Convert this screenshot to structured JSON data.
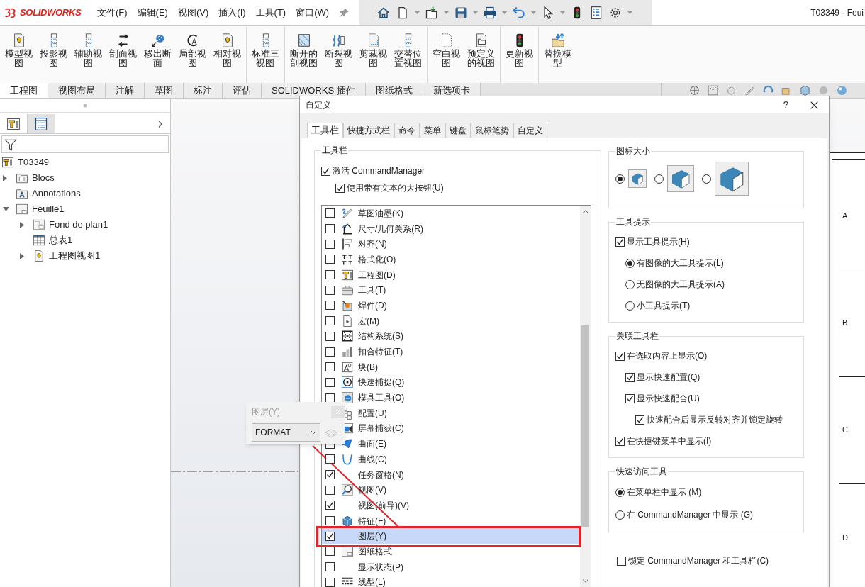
{
  "menu_bar": {
    "logo": "SOLIDWORKS",
    "menus": [
      "文件(F)",
      "编辑(E)",
      "视图(V)",
      "插入(I)",
      "工具(T)",
      "窗口(W)"
    ],
    "title": "T03349 - Feui"
  },
  "command_manager": {
    "groups": [
      [
        {
          "label": "模型视图"
        },
        {
          "label": "投影视图"
        },
        {
          "label": "辅助视图"
        },
        {
          "label": "剖面视图"
        },
        {
          "label": "移出断面"
        },
        {
          "label": "局部视图"
        },
        {
          "label": "相对视图"
        }
      ],
      [
        {
          "label": "标准三视图"
        }
      ],
      [
        {
          "label": "断开的剖视图"
        },
        {
          "label": "断裂视图"
        },
        {
          "label": "剪裁视图"
        },
        {
          "label": "交替位置视图"
        }
      ],
      [
        {
          "label": "空白视图"
        },
        {
          "label": "预定义的视图"
        }
      ],
      [
        {
          "label": "更新视图"
        }
      ],
      [
        {
          "label": "替换模型"
        }
      ]
    ]
  },
  "command_tabs": [
    {
      "label": "工程图",
      "selected": true
    },
    {
      "label": "视图布局",
      "selected": false
    },
    {
      "label": "注解",
      "selected": false
    },
    {
      "label": "草图",
      "selected": false
    },
    {
      "label": "标注",
      "selected": false
    },
    {
      "label": "评估",
      "selected": false
    },
    {
      "label": "SOLIDWORKS 插件",
      "selected": false
    },
    {
      "label": "图纸格式",
      "selected": false
    },
    {
      "label": "新选项卡",
      "selected": false
    }
  ],
  "feature_manager": {
    "tabs": [
      {
        "selected": true
      },
      {
        "selected": false
      }
    ],
    "tree": [
      {
        "label": "T03349",
        "kind": "drawing",
        "children": [
          {
            "label": "Blocs",
            "kind": "blocks",
            "expanded": false
          },
          {
            "label": "Annotations",
            "kind": "annotations"
          },
          {
            "label": "Feuille1",
            "kind": "sheet",
            "expanded": true,
            "children": [
              {
                "label": "Fond de plan1",
                "kind": "sheet_format",
                "expanded": false
              },
              {
                "label": "总表1",
                "kind": "table"
              },
              {
                "label": "工程图视图1",
                "kind": "view",
                "expanded": false
              }
            ]
          }
        ]
      }
    ]
  },
  "sheet": {
    "zones": [
      "A",
      "B",
      "C",
      "D"
    ]
  },
  "layer_toolbar": {
    "title": "图层(Y)",
    "layer": "FORMAT"
  },
  "dialog": {
    "title": "自定义",
    "help": "?",
    "tabs": [
      {
        "label": "工具栏",
        "selected": true
      },
      {
        "label": "快捷方式栏",
        "selected": false
      },
      {
        "label": "命令",
        "selected": false
      },
      {
        "label": "菜单",
        "selected": false
      },
      {
        "label": "键盘",
        "selected": false
      },
      {
        "label": "鼠标笔势",
        "selected": false
      },
      {
        "label": "自定义",
        "selected": false
      }
    ],
    "toolbars": {
      "title": "工具栏",
      "options": [
        {
          "kind": "checkbox",
          "label": "激活 CommandManager",
          "checked": true,
          "children": [
            {
              "kind": "checkbox",
              "label": "使用带有文本的大按钮(U)",
              "checked": true
            }
          ]
        }
      ],
      "list": [
        {
          "label": "草图油墨(K)",
          "checked": false,
          "selected": false
        },
        {
          "label": "尺寸/几何关系(R)",
          "checked": false,
          "selected": false
        },
        {
          "label": "对齐(N)",
          "checked": false,
          "selected": false
        },
        {
          "label": "格式化(O)",
          "checked": false,
          "selected": false
        },
        {
          "label": "工程图(D)",
          "checked": false,
          "selected": false
        },
        {
          "label": "工具(T)",
          "checked": false,
          "selected": false
        },
        {
          "label": "焊件(D)",
          "checked": false,
          "selected": false
        },
        {
          "label": "宏(M)",
          "checked": false,
          "selected": false
        },
        {
          "label": "结构系统(S)",
          "checked": false,
          "selected": false
        },
        {
          "label": "扣合特征(T)",
          "checked": false,
          "selected": false
        },
        {
          "label": "块(B)",
          "checked": false,
          "selected": false
        },
        {
          "label": "快速捕捉(Q)",
          "checked": false,
          "selected": false
        },
        {
          "label": "模具工具(O)",
          "checked": false,
          "selected": false
        },
        {
          "label": "配置(U)",
          "selected": false
        },
        {
          "label": "屏幕捕获(C)",
          "selected": false
        },
        {
          "label": "曲面(E)",
          "checked": false,
          "selected": false
        },
        {
          "label": "曲线(C)",
          "checked": false,
          "selected": false
        },
        {
          "label": "任务窗格(N)",
          "checked": true,
          "selected": false
        },
        {
          "label": "视图(V)",
          "checked": false,
          "selected": false
        },
        {
          "label": "视图(前导)(V)",
          "checked": true,
          "selected": false
        },
        {
          "label": "特征(F)",
          "checked": false,
          "selected": false
        },
        {
          "label": "图层(Y)",
          "checked": true,
          "selected": true
        },
        {
          "label": "图纸格式",
          "checked": false,
          "selected": false
        },
        {
          "label": "显示状态(P)",
          "checked": false,
          "selected": false
        },
        {
          "label": "线型(L)",
          "checked": false,
          "selected": false
        }
      ]
    },
    "icon_size": {
      "title": "图标大小",
      "options": [
        {
          "selected": true
        },
        {
          "selected": false
        },
        {
          "selected": false
        }
      ]
    },
    "groups": [
      {
        "title": "工具提示",
        "options": [
          {
            "kind": "checkbox",
            "label": "显示工具提示(H)",
            "checked": true,
            "children": [
              {
                "kind": "radio",
                "label": "有图像的大工具提示(L)",
                "selected": true
              },
              {
                "kind": "radio",
                "label": "无图像的大工具提示(A)",
                "selected": false
              },
              {
                "kind": "radio",
                "label": "小工具提示(T)",
                "selected": false
              }
            ]
          }
        ]
      },
      {
        "title": "关联工具栏",
        "options": [
          {
            "kind": "checkbox",
            "label": "在选取内容上显示(O)",
            "checked": true,
            "children": [
              {
                "kind": "checkbox",
                "label": "显示快速配置(Q)",
                "checked": true
              },
              {
                "kind": "checkbox",
                "label": "显示快速配合(U)",
                "checked": true,
                "children": [
                  {
                    "kind": "checkbox",
                    "label": "快速配合后显示反转对齐并锁定旋转",
                    "checked": true
                  }
                ]
              }
            ]
          },
          {
            "kind": "checkbox",
            "label": "在快捷键菜单中显示(I)",
            "checked": true
          }
        ]
      },
      {
        "title": "快速访问工具",
        "options": [
          {
            "kind": "radio",
            "label": "在菜单栏中显示 (M)",
            "selected": true
          },
          {
            "kind": "radio",
            "label": "在 CommandManager 中显示 (G)",
            "selected": false
          }
        ]
      }
    ],
    "lock": {
      "kind": "checkbox",
      "label": "锁定 CommandManager 和工具栏(C)",
      "checked": false
    }
  }
}
